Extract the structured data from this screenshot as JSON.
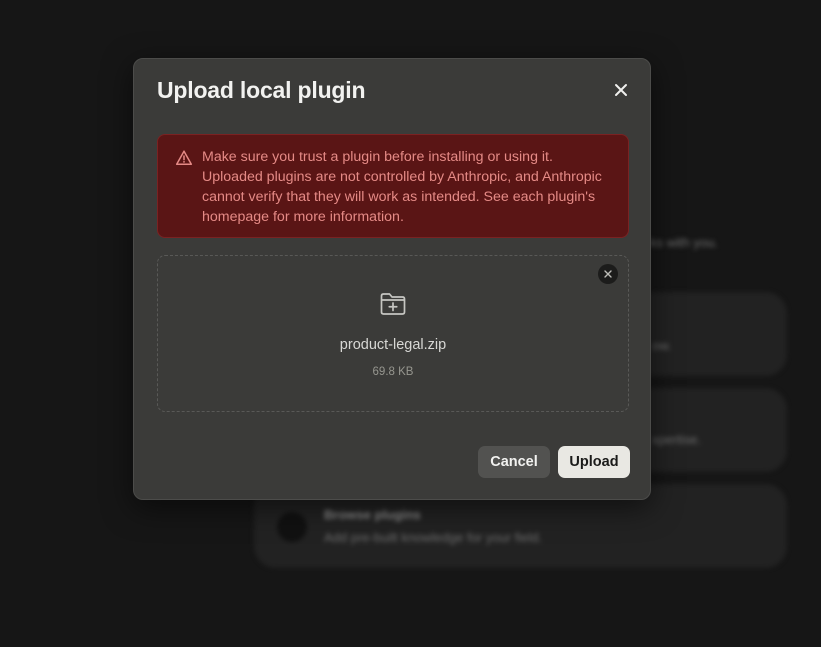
{
  "background": {
    "subtitle_fragment": "ks with you.",
    "cards": [
      {
        "title": "",
        "desc_fragment": "ow."
      },
      {
        "title": "",
        "desc_fragment": "xpertise."
      },
      {
        "title": "Browse plugins",
        "desc": "Add pre-built knowledge for your field."
      }
    ]
  },
  "modal": {
    "title": "Upload local plugin",
    "close_icon": "close-icon",
    "warning": {
      "icon": "warning-triangle-icon",
      "text": "Make sure you trust a plugin before installing or using it. Uploaded plugins are not controlled by Anthropic, and Anthropic cannot verify that they will work as intended. See each plugin's homepage for more information."
    },
    "dropzone": {
      "icon": "folder-plus-icon",
      "file_name": "product-legal.zip",
      "file_size": "69.8 KB",
      "remove_icon": "close-icon"
    },
    "cancel_label": "Cancel",
    "upload_label": "Upload"
  },
  "colors": {
    "page_bg": "#161616",
    "modal_bg": "#3b3b39",
    "warning_bg": "#5a1515",
    "warning_text": "#e58a86",
    "upload_button_bg": "#e9e8e3",
    "cancel_button_bg": "#525250"
  }
}
